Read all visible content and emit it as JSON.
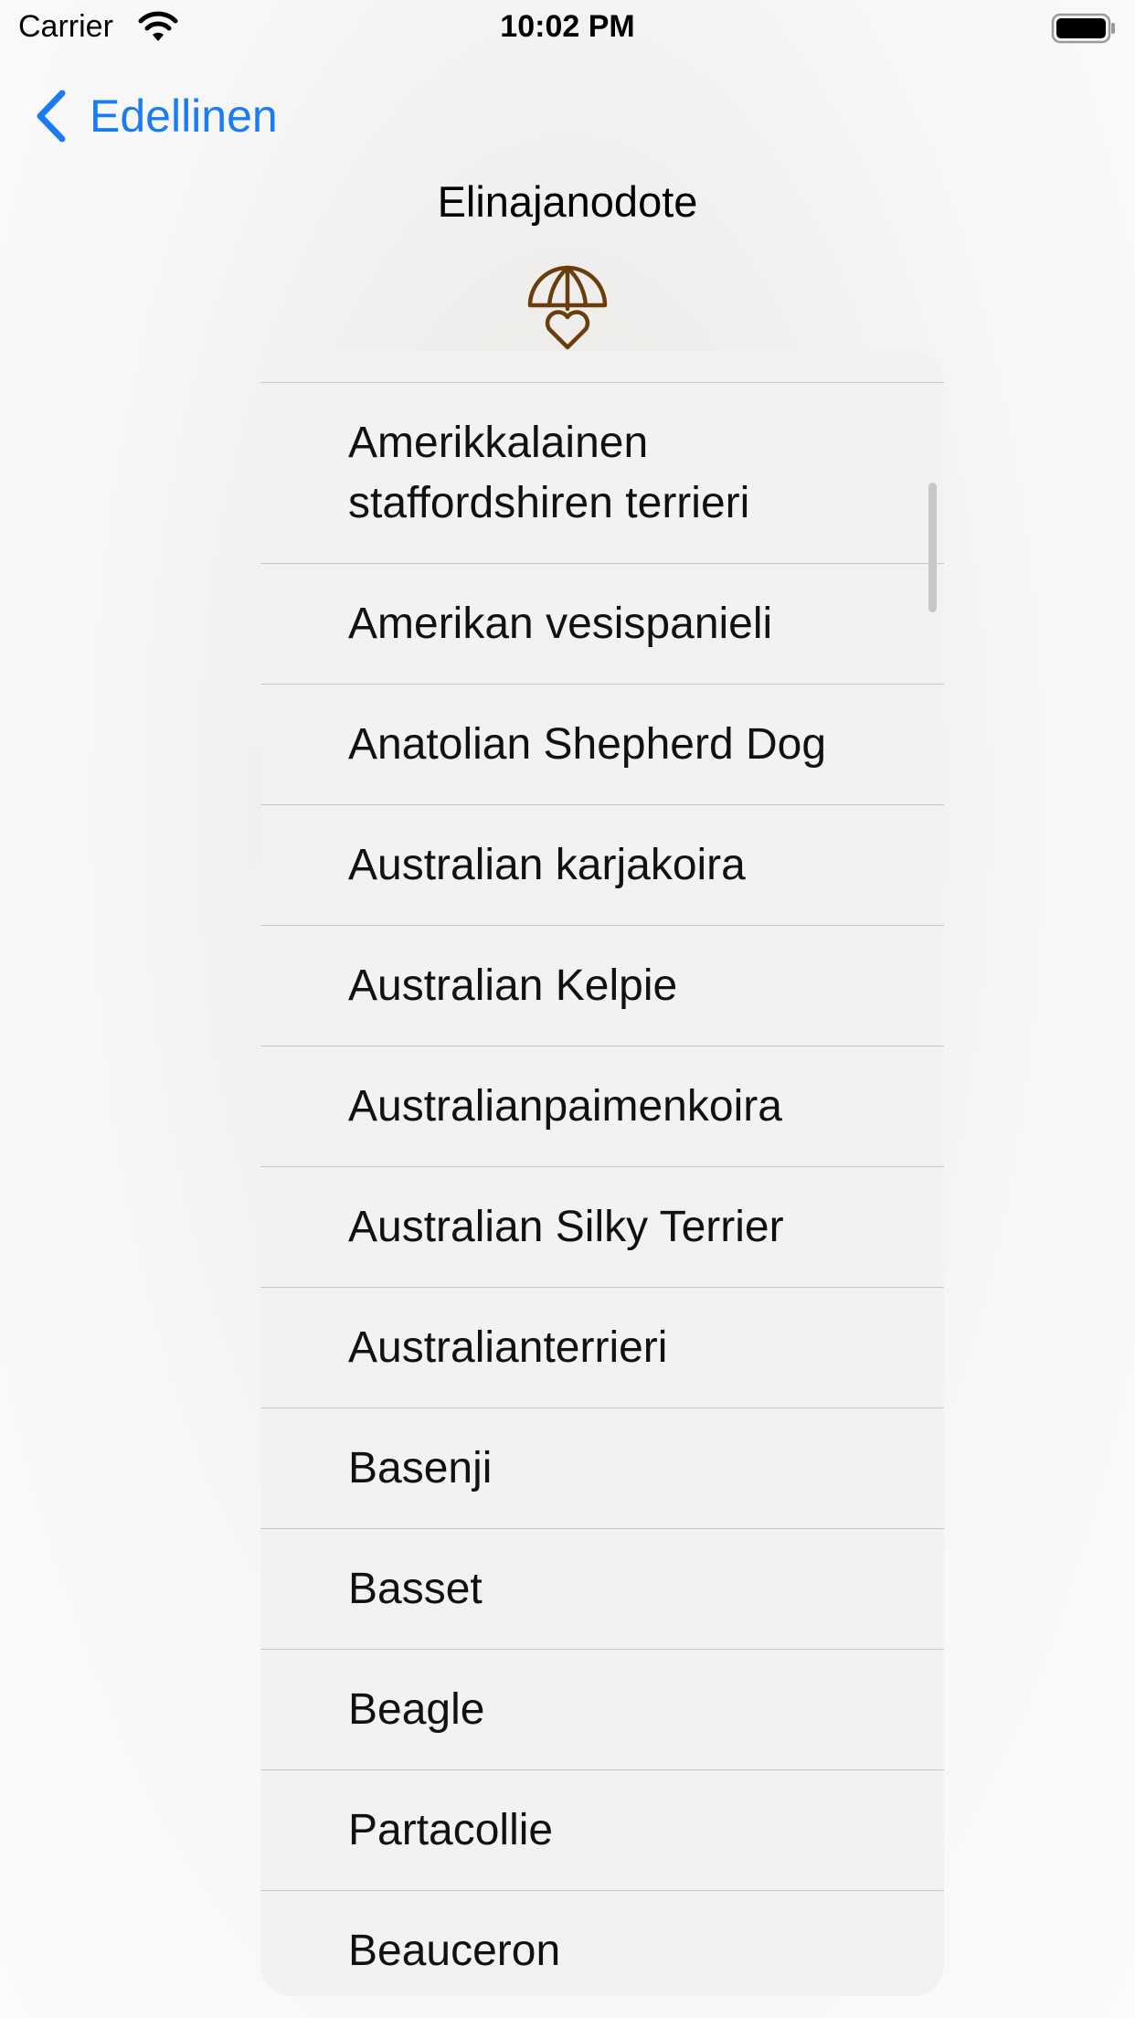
{
  "status_bar": {
    "carrier": "Carrier",
    "time": "10:02 PM"
  },
  "nav": {
    "back_label": "Edellinen",
    "accent_color": "#1a7cf5"
  },
  "page": {
    "title": "Elinajanodote",
    "icon": "umbrella-heart-icon",
    "icon_color": "#6b3d0c"
  },
  "breed_list": {
    "items": [
      "Amerikkalainen staffordshiren terrieri",
      "Amerikan vesispanieli",
      "Anatolian Shepherd Dog",
      "Australian karjakoira",
      "Australian Kelpie",
      "Australianpaimenkoira",
      "Australian Silky Terrier",
      "Australianterrieri",
      "Basenji",
      "Basset",
      "Beagle",
      "Partacollie",
      "Beauceron"
    ]
  }
}
